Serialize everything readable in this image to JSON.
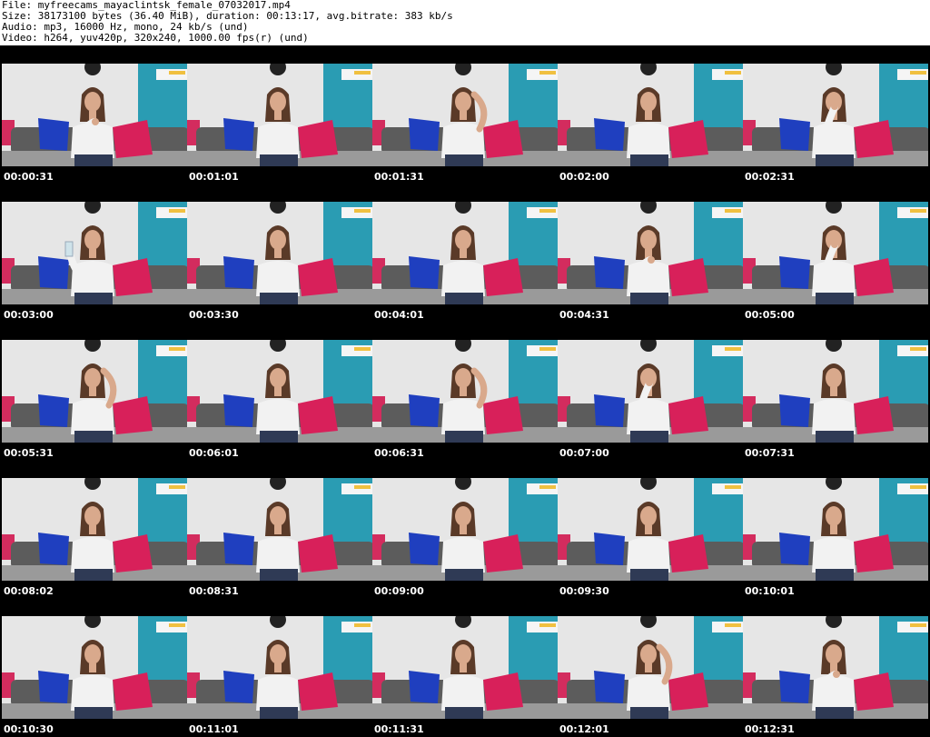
{
  "header": {
    "lines": [
      "File: myfreecams_mayaclintsk_female_07032017.mp4",
      "Size: 38173100 bytes (36.40 MiB), duration: 00:13:17, avg.bitrate: 383 kb/s",
      "Audio: mp3, 16000 Hz, mono, 24 kb/s (und)",
      "Video: h264, yuv420p, 320x240, 1000.00 fps(r) (und)"
    ]
  },
  "thumbnails": [
    {
      "timestamp": "00:00:31",
      "pose": "hand-on-chest"
    },
    {
      "timestamp": "00:01:01",
      "pose": "neutral"
    },
    {
      "timestamp": "00:01:31",
      "pose": "hand-on-head"
    },
    {
      "timestamp": "00:02:00",
      "pose": "neutral"
    },
    {
      "timestamp": "00:02:31",
      "pose": "hand-on-chin"
    },
    {
      "timestamp": "00:03:00",
      "pose": "holding-glass"
    },
    {
      "timestamp": "00:03:30",
      "pose": "neutral"
    },
    {
      "timestamp": "00:04:01",
      "pose": "neutral"
    },
    {
      "timestamp": "00:04:31",
      "pose": "hand-on-chest"
    },
    {
      "timestamp": "00:05:00",
      "pose": "hand-on-chin"
    },
    {
      "timestamp": "00:05:31",
      "pose": "hand-on-head"
    },
    {
      "timestamp": "00:06:01",
      "pose": "neutral"
    },
    {
      "timestamp": "00:06:31",
      "pose": "hand-on-head"
    },
    {
      "timestamp": "00:07:00",
      "pose": "hand-on-chin"
    },
    {
      "timestamp": "00:07:31",
      "pose": "neutral"
    },
    {
      "timestamp": "00:08:02",
      "pose": "neutral"
    },
    {
      "timestamp": "00:08:31",
      "pose": "neutral"
    },
    {
      "timestamp": "00:09:00",
      "pose": "neutral"
    },
    {
      "timestamp": "00:09:30",
      "pose": "neutral"
    },
    {
      "timestamp": "00:10:01",
      "pose": "neutral"
    },
    {
      "timestamp": "00:10:30",
      "pose": "neutral"
    },
    {
      "timestamp": "00:11:01",
      "pose": "neutral"
    },
    {
      "timestamp": "00:11:31",
      "pose": "neutral"
    },
    {
      "timestamp": "00:12:01",
      "pose": "hand-on-head"
    },
    {
      "timestamp": "00:12:31",
      "pose": "hand-on-chest"
    }
  ],
  "colors": {
    "background_wall": "#e6e6e6",
    "teal_wall": "#2a9cb3",
    "sofa": "#5c5c5c",
    "blue_pillow": "#1f3fbf",
    "pink_pillow": "#d8205a",
    "shirt": "#f2f2f2",
    "hair": "#5a3a28",
    "skin": "#d9a98c",
    "jeans": "#2f3a55"
  }
}
